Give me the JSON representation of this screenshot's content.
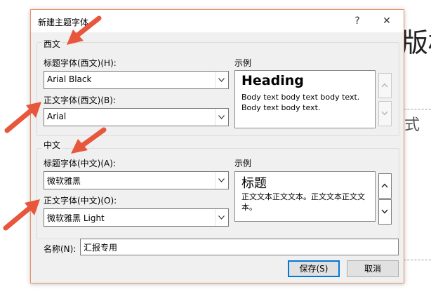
{
  "background": {
    "glyph_top": "版权",
    "glyph_mid": "式"
  },
  "dialog": {
    "title": "新建主题字体",
    "help_label": "?",
    "close_label": "✕",
    "western": {
      "group_label": "西文",
      "heading_font_label": "标题字体(西文)(H):",
      "heading_font_value": "Arial Black",
      "body_font_label": "正文字体(西文)(B):",
      "body_font_value": "Arial",
      "sample_label": "示例",
      "sample_heading": "Heading",
      "sample_body": "Body text body text body text. Body text body text."
    },
    "east_asian": {
      "group_label": "中文",
      "heading_font_label": "标题字体(中文)(A):",
      "heading_font_value": "微软雅黑",
      "body_font_label": "正文字体(中文)(O):",
      "body_font_value": "微软雅黑 Light",
      "sample_label": "示例",
      "sample_heading": "标题",
      "sample_body": "正文文本正文文本。正文文本正文文本。"
    },
    "name_label": "名称(N):",
    "name_value": "汇报专用",
    "save_label": "保存(S)",
    "cancel_label": "取消"
  },
  "colors": {
    "annotation_arrow": "#e8563c",
    "default_button_border": "#0078d7",
    "dialog_border": "#e8926b"
  }
}
